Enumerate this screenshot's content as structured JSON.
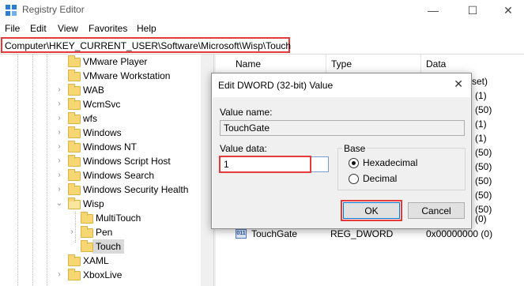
{
  "window": {
    "title": "Registry Editor",
    "minimize": "—",
    "maximize": "☐",
    "close": "✕"
  },
  "menu": [
    "File",
    "Edit",
    "View",
    "Favorites",
    "Help"
  ],
  "address": "Computer\\HKEY_CURRENT_USER\\Software\\Microsoft\\Wisp\\Touch",
  "tree": {
    "items": [
      {
        "label": "VMware Player"
      },
      {
        "label": "VMware Workstation"
      },
      {
        "label": "WAB"
      },
      {
        "label": "WcmSvc"
      },
      {
        "label": "wfs"
      },
      {
        "label": "Windows"
      },
      {
        "label": "Windows NT"
      },
      {
        "label": "Windows Script Host"
      },
      {
        "label": "Windows Search"
      },
      {
        "label": "Windows Security Health"
      },
      {
        "label": "Wisp"
      },
      {
        "label": "MultiTouch"
      },
      {
        "label": "Pen"
      },
      {
        "label": "Touch"
      },
      {
        "label": "XAML"
      },
      {
        "label": "XboxLive"
      }
    ]
  },
  "list": {
    "columns": [
      "Name",
      "Type",
      "Data"
    ],
    "data_fragments": [
      "set)",
      "(1)",
      "(50)",
      "(1)",
      "(1)",
      "(50)",
      "(50)",
      "(50)",
      "(50)",
      "(50)",
      "(0)"
    ],
    "last_row": {
      "name": "TouchGate",
      "type": "REG_DWORD",
      "data": "0x00000000 (0)"
    }
  },
  "dialog": {
    "title": "Edit DWORD (32-bit) Value",
    "close": "✕",
    "value_name_label": "Value name:",
    "value_name": "TouchGate",
    "value_data_label": "Value data:",
    "value_data": "1",
    "base_label": "Base",
    "base_options": [
      "Hexadecimal",
      "Decimal"
    ],
    "base_selected": "Hexadecimal",
    "ok": "OK",
    "cancel": "Cancel"
  },
  "colors": {
    "highlight": "#e53a3a",
    "folder": "#f7d774"
  }
}
